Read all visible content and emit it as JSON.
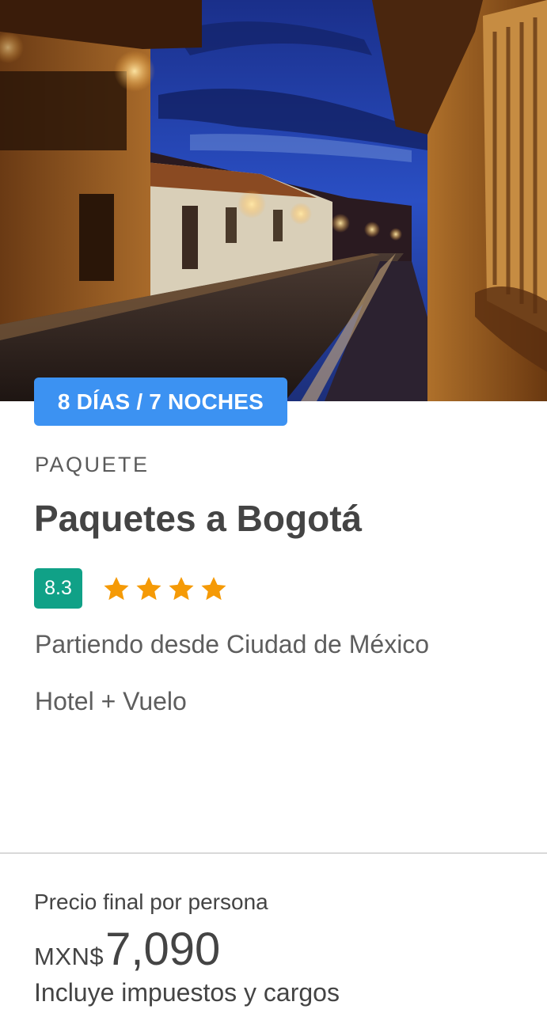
{
  "hero": {
    "image": "colonial-street-night-photo"
  },
  "badge": {
    "duration": "8 DÍAS / 7 NOCHES"
  },
  "package": {
    "category": "PAQUETE",
    "title": "Paquetes a Bogotá",
    "score": "8.3",
    "stars": 4,
    "origin": "Partiendo desde Ciudad de México",
    "includes": "Hotel + Vuelo"
  },
  "price": {
    "label": "Precio final por persona",
    "currency": "MXN$",
    "amount": "7,090",
    "note": "Incluye impuestos y cargos"
  },
  "colors": {
    "badge_blue": "#3c92f2",
    "score_green": "#10a187",
    "star_orange": "#f59a06"
  }
}
